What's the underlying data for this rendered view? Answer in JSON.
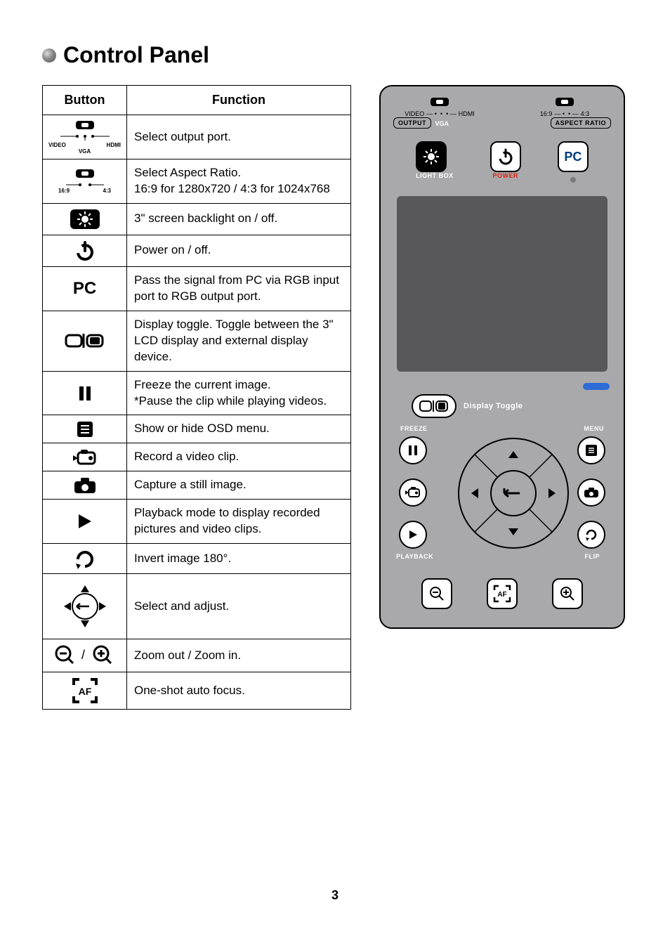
{
  "title": "Control Panel",
  "table": {
    "headers": {
      "button": "Button",
      "function": "Function"
    },
    "rows": [
      {
        "icon": "output-slider",
        "function": "Select output port."
      },
      {
        "icon": "aspect-slider",
        "function": "Select Aspect Ratio.\n16:9 for 1280x720 / 4:3 for 1024x768"
      },
      {
        "icon": "lightbox",
        "function": "3\" screen backlight on / off."
      },
      {
        "icon": "power",
        "function": "Power on / off."
      },
      {
        "icon": "pc",
        "function": "Pass the signal from PC via RGB input port to RGB output port."
      },
      {
        "icon": "display-toggle",
        "function": "Display toggle. Toggle between the 3\" LCD display and external display device."
      },
      {
        "icon": "freeze",
        "function": "Freeze the current image.\n*Pause the clip while playing videos."
      },
      {
        "icon": "menu",
        "function": "Show or hide OSD menu."
      },
      {
        "icon": "record",
        "function": "Record a video clip."
      },
      {
        "icon": "capture",
        "function": "Capture a still image."
      },
      {
        "icon": "playback",
        "function": "Playback mode to display recorded pictures and video clips."
      },
      {
        "icon": "flip",
        "function": "Invert image 180°."
      },
      {
        "icon": "dpad",
        "function": "Select and adjust."
      },
      {
        "icon": "zoom",
        "function": "Zoom out / Zoom in."
      },
      {
        "icon": "af",
        "function": "One-shot auto focus."
      }
    ]
  },
  "slider_output": {
    "left": "VIDEO",
    "right": "HDMI",
    "bottom": "VGA"
  },
  "slider_aspect": {
    "left": "16:9",
    "right": "4:3"
  },
  "panel": {
    "output_btn": "OUTPUT",
    "output_sub": "VGA",
    "aspect_btn": "ASPECT RATIO",
    "lightbox_label": "LIGHT BOX",
    "power_label": "POWER",
    "pc_label": "PC",
    "display_toggle_label": "Display Toggle",
    "freeze_label": "FREEZE",
    "menu_label": "MENU",
    "playback_label": "PLAYBACK",
    "flip_label": "FLIP"
  },
  "page_number": "3"
}
